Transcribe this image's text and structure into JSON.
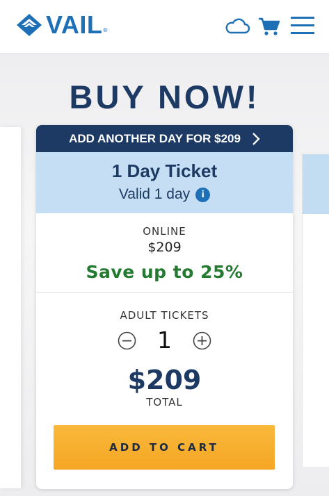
{
  "header": {
    "logo_text": "VAIL",
    "logo_mark": "®",
    "icons": [
      "logo-diamond-icon",
      "cloud-icon",
      "cart-icon",
      "menu-icon"
    ]
  },
  "page": {
    "title": "BUY NOW!"
  },
  "card": {
    "upsell_label": "ADD ANOTHER DAY FOR $209",
    "upsell_chevron": "›",
    "ticket_name": "1 Day Ticket",
    "ticket_validity": "Valid 1 day",
    "info_glyph": "i",
    "online_label": "ONLINE",
    "online_price": "$209",
    "savings_text": "Save up to 25%",
    "adult_tickets_label": "ADULT TICKETS",
    "quantity": "1",
    "total_price": "$209",
    "total_label": "TOTAL",
    "cta_label": "ADD TO CART"
  },
  "colors": {
    "brand_blue": "#1d6fb6",
    "navy": "#1c3a63",
    "ticket_band": "#c5def3",
    "savings_green": "#257a31",
    "cta_orange": "#f5a623"
  }
}
